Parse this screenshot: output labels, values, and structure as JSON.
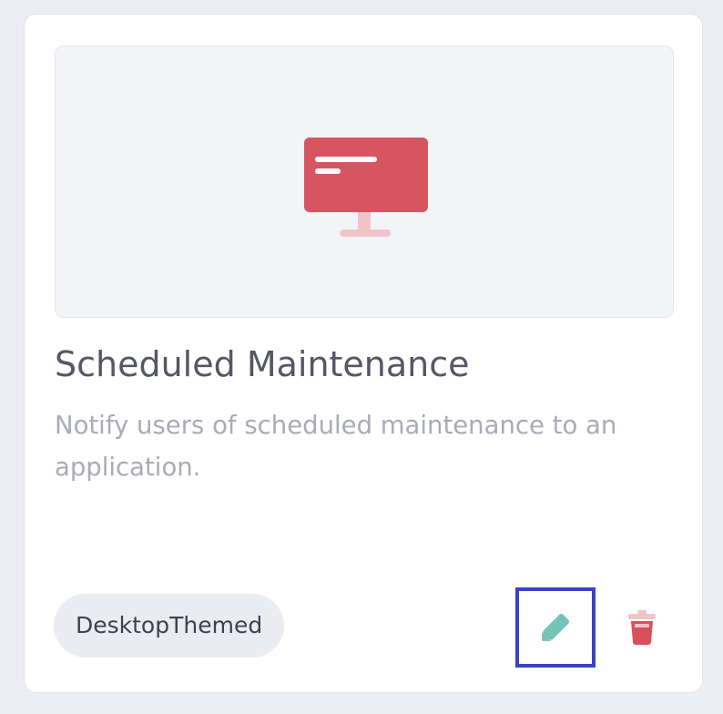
{
  "card": {
    "title": "Scheduled Maintenance",
    "description": "Notify users of scheduled maintenance to an application.",
    "tag": "DesktopThemed",
    "preview_icon": "desktop-monitor-icon",
    "actions": {
      "edit_icon": "pencil-icon",
      "delete_icon": "trash-icon"
    }
  },
  "colors": {
    "background": "#ebecf4",
    "card": "#ffffff",
    "preview_bg": "#f3f4f8",
    "monitor_red": "#d65561",
    "monitor_stand": "#f0c4c9",
    "edit_teal": "#76c3b8",
    "delete_red": "#d9505d",
    "focus_outline": "#3b41c9"
  }
}
